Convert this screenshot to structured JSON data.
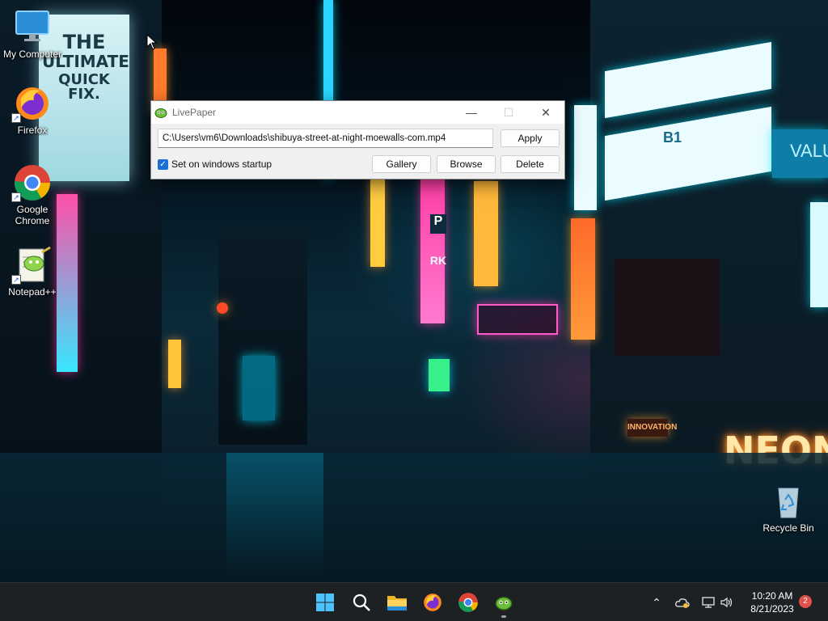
{
  "desktop": {
    "icons": [
      {
        "label": "My Computer"
      },
      {
        "label": "Firefox"
      },
      {
        "label": "Google Chrome"
      },
      {
        "label": "Notepad++"
      },
      {
        "label": "Recycle Bin"
      }
    ],
    "wallpaper_signs": {
      "billboard_line1": "THE",
      "billboard_line2": "ULTIMATE",
      "billboard_line3": "QUICK FIX.",
      "neon": "NEON",
      "innovation": "INNOVATION",
      "parking": "P",
      "rk": "RK",
      "b1": "B1",
      "valu": "VALU"
    }
  },
  "window": {
    "title": "LivePaper",
    "path_value": "C:\\Users\\vm6\\Downloads\\shibuya-street-at-night-moewalls-com.mp4",
    "apply_label": "Apply",
    "startup_label": "Set on windows startup",
    "startup_checked": true,
    "gallery_label": "Gallery",
    "browse_label": "Browse",
    "delete_label": "Delete"
  },
  "taskbar": {
    "apps": [
      "start-icon",
      "search-icon",
      "file-explorer-icon",
      "firefox-icon",
      "chrome-icon",
      "livepaper-icon"
    ],
    "time": "10:20 AM",
    "date": "8/21/2023",
    "notification_count": "2"
  },
  "colors": {
    "accent": "#1a6fd6",
    "taskbar": "#1e2124",
    "badge": "#e0504a"
  }
}
